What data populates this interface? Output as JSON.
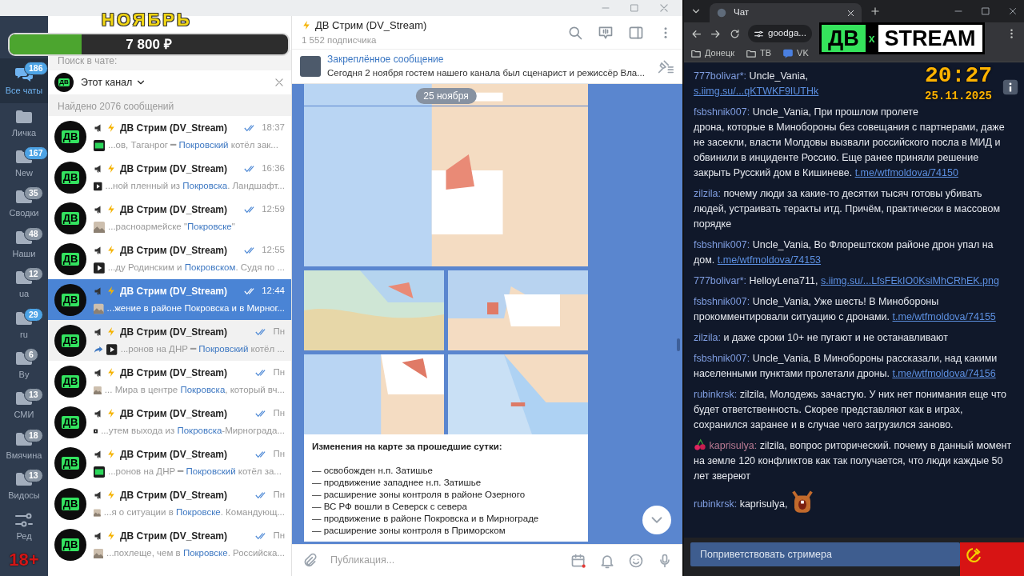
{
  "overlay": {
    "month": "НОЯБРЬ",
    "goal": {
      "amount": "7 800 ₽",
      "level": 0.26
    },
    "logo": {
      "left": "ДВ",
      "middle": "x",
      "right": "STREAM"
    },
    "clock": "20:27",
    "date": "25.11.2025",
    "age_rating": "18+"
  },
  "folders": [
    {
      "kind": "all",
      "label": "Все чаты",
      "badge": "186",
      "muted": false,
      "selected": true
    },
    {
      "kind": "folder",
      "label": "Личка",
      "selected": false
    },
    {
      "kind": "folder",
      "label": "New",
      "badge": "167",
      "muted": false,
      "selected": false
    },
    {
      "kind": "folder",
      "label": "Сводки",
      "badge": "35",
      "muted": true,
      "selected": false
    },
    {
      "kind": "folder",
      "label": "Наши",
      "badge": "48",
      "muted": true,
      "selected": false
    },
    {
      "kind": "folder",
      "label": "ua",
      "badge": "12",
      "muted": true,
      "selected": false
    },
    {
      "kind": "folder",
      "label": "ru",
      "badge": "29",
      "muted": false,
      "selected": false
    },
    {
      "kind": "folder",
      "label": "By",
      "badge": "6",
      "muted": true,
      "selected": false
    },
    {
      "kind": "folder",
      "label": "СМИ",
      "badge": "13",
      "muted": true,
      "selected": false
    },
    {
      "kind": "folder",
      "label": "Вмячина",
      "badge": "18",
      "muted": true,
      "selected": false
    },
    {
      "kind": "folder",
      "label": "Видосы",
      "badge": "13",
      "muted": true,
      "selected": false
    },
    {
      "kind": "edit",
      "label": "Ред",
      "selected": false
    }
  ],
  "search": {
    "scope_label": "Поиск в чате:",
    "scope": {
      "avatar_text": "ДВ",
      "label": "Этот канал"
    },
    "results_count": "Найдено 2076 сообщений"
  },
  "results": [
    {
      "avatar_text": "ДВ",
      "name": "ДВ Стрим (DV_Stream)",
      "time": "18:37",
      "kind": "dv",
      "forwarded": false,
      "prefix": "...ов, Таганрог ━ ",
      "match": "Покровский",
      "suffix": " котёл зак...",
      "selected": false,
      "hovered": false
    },
    {
      "avatar_text": "ДВ",
      "name": "ДВ Стрим (DV_Stream)",
      "time": "16:36",
      "kind": "video",
      "forwarded": false,
      "prefix": "...ной пленный из ",
      "match": "Покровска",
      "suffix": ".  Ландшафт...",
      "selected": false,
      "hovered": false
    },
    {
      "avatar_text": "ДВ",
      "name": "ДВ Стрим (DV_Stream)",
      "time": "12:59",
      "kind": "photo",
      "forwarded": false,
      "prefix": "...расноармейске \"",
      "match": "Покровске",
      "suffix": "\"",
      "selected": false,
      "hovered": false
    },
    {
      "avatar_text": "ДВ",
      "name": "ДВ Стрим (DV_Stream)",
      "time": "12:55",
      "kind": "video",
      "forwarded": false,
      "prefix": "...ду Родинским и ",
      "match": "Покровском",
      "suffix": ".  Судя по ...",
      "selected": false,
      "hovered": false
    },
    {
      "avatar_text": "ДВ",
      "name": "ДВ Стрим (DV_Stream)",
      "time": "12:44",
      "kind": "photo",
      "forwarded": false,
      "prefix": "...жение в районе ",
      "match": "Покровска",
      "suffix": " и в Мирног...",
      "selected": true,
      "hovered": false
    },
    {
      "avatar_text": "ДВ",
      "name": "ДВ Стрим (DV_Stream)",
      "time": "Пн",
      "kind": "video",
      "forwarded": true,
      "prefix": "...ронов на ДНР ━ ",
      "match": "Покровский",
      "suffix": " котёл ...",
      "selected": false,
      "hovered": true
    },
    {
      "avatar_text": "ДВ",
      "name": "ДВ Стрим (DV_Stream)",
      "time": "Пн",
      "kind": "photo",
      "forwarded": false,
      "prefix": "... Мира в центре ",
      "match": "Покровска",
      "suffix": ", который вч...",
      "selected": false,
      "hovered": false
    },
    {
      "avatar_text": "ДВ",
      "name": "ДВ Стрим (DV_Stream)",
      "time": "Пн",
      "kind": "video",
      "forwarded": false,
      "prefix": "...утем выхода из ",
      "match": "Покровска",
      "suffix": "-Мирнограда...",
      "selected": false,
      "hovered": false
    },
    {
      "avatar_text": "ДВ",
      "name": "ДВ Стрим (DV_Stream)",
      "time": "Пн",
      "kind": "dv",
      "forwarded": false,
      "prefix": "...ронов на ДНР ━ ",
      "match": "Покровский",
      "suffix": " котёл за...",
      "selected": false,
      "hovered": false
    },
    {
      "avatar_text": "ДВ",
      "name": "ДВ Стрим (DV_Stream)",
      "time": "Пн",
      "kind": "photo",
      "forwarded": false,
      "prefix": "...я о ситуации в ",
      "match": "Покровске",
      "suffix": ".  Командующ...",
      "selected": false,
      "hovered": false
    },
    {
      "avatar_text": "ДВ",
      "name": "ДВ Стрим (DV_Stream)",
      "time": "Пн",
      "kind": "photo",
      "forwarded": false,
      "prefix": "...похлеще, чем в ",
      "match": "Покровске",
      "suffix": ".  Российска...",
      "selected": false,
      "hovered": false
    }
  ],
  "channel": {
    "title": "ДВ Стрим (DV_Stream)",
    "subscribers": "1 552 подписчика",
    "pinned": {
      "title": "Закреплённое сообщение",
      "text": "Сегодня 2 ноября гостем нашего канала был сценарист и режиссёр Вла..."
    },
    "date_badge": "25 ноября",
    "message": {
      "heading": "Изменения на карте за прошедшие сутки:",
      "lines": [
        "— освобожден н.п. Затишье",
        "— продвижение западнее н.п. Затишье",
        "— расширение зоны контроля в районе Озерного",
        "— ВС РФ вошли в Северск с севера",
        "— продвижение в районе Покровска и в Мирнограде",
        "— расширение зоны контроля в Приморском"
      ]
    },
    "composer": {
      "placeholder": "Публикация..."
    }
  },
  "browser": {
    "tab": "Чат",
    "address": "goodga...",
    "bookmarks": [
      {
        "kind": "folder",
        "label": "Донецк"
      },
      {
        "kind": "folder",
        "label": "ТВ"
      },
      {
        "kind": "chat",
        "label": "VK"
      }
    ]
  },
  "chat": {
    "messages": [
      {
        "user": "777bolivar*:",
        "color": "#7f9de0",
        "badge": false,
        "text": "Uncle_Vania,",
        "link": "s.iimg.su/...qKTWKF9IUTHk",
        "emote": false
      },
      {
        "user": "fsbshnik007:",
        "color": "#7f9de0",
        "badge": false,
        "text": "Uncle_Vania, При прошлом пролете дрона, которые в Минобороны без совещания с партнерами, даже не засекли, власти Молдовы вызвали российского посла в МИД и обвинили в инциденте Россию. Еще ранее приняли решение закрыть Русский дом в Кишиневе.",
        "link": "t.me/wtfmoldova/74150",
        "emote": false
      },
      {
        "user": "zilzila:",
        "color": "#7f9de0",
        "badge": false,
        "text": "почему люди за какие-то десятки тысяч готовы убивать людей, устраивать теракты итд. Причём, практически в массовом порядке",
        "emote": false
      },
      {
        "user": "fsbshnik007:",
        "color": "#7f9de0",
        "badge": false,
        "text": "Uncle_Vania, Во Флорештском районе дрон упал на дом.",
        "link": "t.me/wtfmoldova/74153",
        "emote": false
      },
      {
        "user": "777bolivar*:",
        "color": "#7f9de0",
        "badge": false,
        "text": "HelloyLena711,",
        "link": "s.iimg.su/...LfsFEkIO0KsiMhCRhEK.png",
        "emote": false
      },
      {
        "user": "fsbshnik007:",
        "color": "#7f9de0",
        "badge": false,
        "text": "Uncle_Vania, Уже шесть! В Минобороны прокомментировали ситуацию с дронами.",
        "link": "t.me/wtfmoldova/74155",
        "emote": false
      },
      {
        "user": "zilzila:",
        "color": "#7f9de0",
        "badge": false,
        "text": "и даже сроки 10+ не пугают и не останавливают",
        "emote": false
      },
      {
        "user": "fsbshnik007:",
        "color": "#7f9de0",
        "badge": false,
        "text": "Uncle_Vania, В Минобороны рассказали, над какими населенными пунктами пролетали дроны.",
        "link": "t.me/wtfmoldova/74156",
        "emote": false
      },
      {
        "user": "rubinkrsk:",
        "color": "#7f9de0",
        "badge": false,
        "text": "zilzila, Молодежь зачастую. У них нет понимания еще что будет ответственность. Скорее представляют как в играх, сохранился заранее и в случае чего загрузился заново.",
        "emote": false
      },
      {
        "user": "kaprisulya:",
        "color": "#b97a93",
        "badge": true,
        "text": "zilzila, вопрос риторический. почему в данный момент на земле 120 конфликтов как так получается, что люди каждые 50 лет звереют",
        "emote": false
      },
      {
        "user": "rubinkrsk:",
        "color": "#7f9de0",
        "badge": false,
        "text": "kaprisulya,",
        "emote": true
      }
    ],
    "greet_button": "Поприветствовать стримера"
  }
}
